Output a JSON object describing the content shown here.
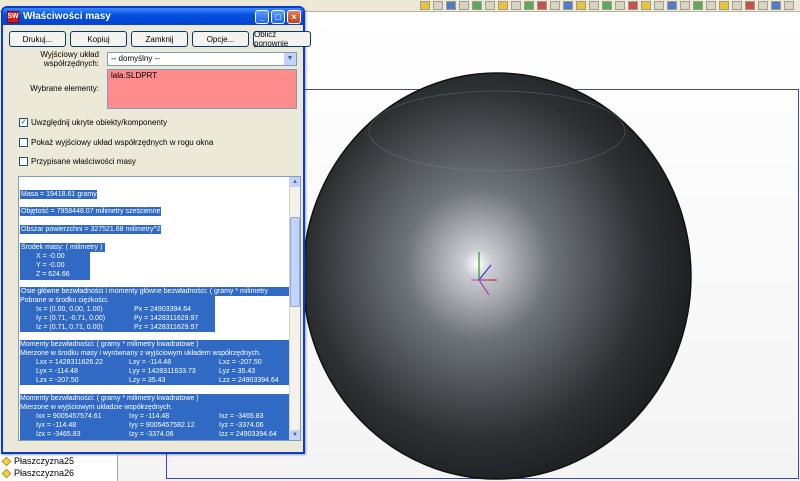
{
  "dialog": {
    "title": "Właściwości masy",
    "app_icon_text": "SW",
    "buttons": {
      "print": "Drukuj...",
      "copy": "Kopiuj",
      "close": "Zamknij",
      "options": "Opcje...",
      "recalc": "Oblicz ponownie"
    },
    "coord_label_1": "Wyjściowy układ",
    "coord_label_2": "współrzędnych:",
    "coord_value": "-- domyślny --",
    "selected_label": "Wybrane elementy:",
    "selected_value": "lala.SLDPRT",
    "checkboxes": {
      "hidden": {
        "label": "Uwzględnij ukryte obiekty/komponenty",
        "checked": true
      },
      "show_cs": {
        "label": "Pokaż wyjściowy układ współrzędnych w rogu okna",
        "checked": false
      },
      "assigned": {
        "label": "Przypisane właściwości masy",
        "checked": false
      }
    }
  },
  "results": {
    "mass": "Masa = 19418.61 gramy",
    "volume": "Objętość = 7958448.07 milimetry sześcienne",
    "area": "Obszar powierzchni = 327521.68 milimetry^2",
    "com_header": "Środek masy: ( milimetry )",
    "com_x": "X = -0.00",
    "com_y": "Y = -0.00",
    "com_z": "Z = 624.66",
    "principal_header": "Osie główne bezwładności i momenty główne bezwładności: ( gramy * milimetry",
    "principal_sub": "Pobrane w środku ciężkości.",
    "principal_rows": [
      {
        "axis": "Ix = (0.00, 0.00, 1.00)",
        "moment": "Px = 24903394.64"
      },
      {
        "axis": "Iy = (0.71, -0.71, 0.00)",
        "moment": "Py = 1428311629.97"
      },
      {
        "axis": "Iz = (0.71, 0.71, 0.00)",
        "moment": "Pz = 1428311629.97"
      }
    ],
    "moments_header": "Momenty bezwładności: ( gramy * milimetry kwadratowe )",
    "moments_sub": "Mierzone w środku masy i wyrównany z wyjściowym układem współrzędnych.",
    "moments_rows": [
      [
        "Lxx = 1428311626.22",
        "Lxy = -114.48",
        "Lxz = -207.50"
      ],
      [
        "Lyx = -114.48",
        "Lyy = 1428311633.73",
        "Lyz = 35.43"
      ],
      [
        "Lzx = -207.50",
        "Lzy = 35.43",
        "Lzz = 24903394.64"
      ]
    ],
    "output_header": "Momenty bezwładności: ( gramy * milimetry kwadratowe )",
    "output_sub": "Mierzone w wyjściowym układzie współrzędnych.",
    "output_rows": [
      [
        "Ixx = 9005457574.61",
        "Ixy = -114.48",
        "Ixz = -3465.83"
      ],
      [
        "Iyx = -114.48",
        "Iyy = 9005457582.12",
        "Iyz = -3374.06"
      ],
      [
        "Izx = -3465.83",
        "Izy = -3374.06",
        "Izz = 24903394.64"
      ]
    ]
  },
  "tree": {
    "items": [
      "Płaszczyzna25",
      "Płaszczyzna26"
    ]
  },
  "colors": {
    "highlight": "#316ac5",
    "selection_box": "#ff8c8c",
    "title_bar": "#0551e0",
    "frame": "#3d48a8"
  }
}
